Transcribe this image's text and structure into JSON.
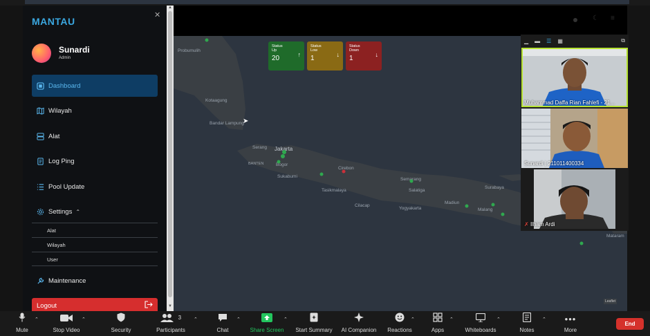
{
  "app": {
    "brand": "MANTAU",
    "user_name": "Sunardi",
    "user_role": "Admin"
  },
  "sidebar": {
    "items": [
      {
        "label": "Dashboard",
        "icon": "dashboard-icon",
        "active": true
      },
      {
        "label": "Wilayah",
        "icon": "map-icon"
      },
      {
        "label": "Alat",
        "icon": "server-icon"
      },
      {
        "label": "Log Ping",
        "icon": "log-icon"
      },
      {
        "label": "Pool Update",
        "icon": "list-icon"
      },
      {
        "label": "Settings",
        "icon": "gear-icon",
        "expanded": true
      }
    ],
    "settings_sub": [
      "Alat",
      "Wilayah",
      "User"
    ],
    "maintenance": "Maintenance",
    "logout": "Logout"
  },
  "status_cards": [
    {
      "title": "Status",
      "subtitle": "Up",
      "value": "20",
      "color": "#1f6b2a",
      "arrow": "↑"
    },
    {
      "title": "Status",
      "subtitle": "Low",
      "value": "1",
      "color": "#8a6a14",
      "arrow": "↓"
    },
    {
      "title": "Status",
      "subtitle": "Down",
      "value": "1",
      "color": "#8c2121",
      "arrow": "↓"
    }
  ],
  "map_labels": [
    "Probumulih",
    "Kotaagung",
    "Bandar Lampung",
    "Serang",
    "Jakarta",
    "BANTEN",
    "Bogor",
    "Sukabumi",
    "Cirebon",
    "Tasikmalaya",
    "Semarang",
    "Cilacap",
    "Yogyakarta",
    "Salatiga",
    "Madiun",
    "Surabaya",
    "Malang",
    "Mataram"
  ],
  "participants": [
    {
      "name": "Muhammad Daffa Rian Fahlefi - 21...",
      "speaking": true
    },
    {
      "name": "Sunardi | 211011400334",
      "speaking": false
    },
    {
      "name": "Ilham Ardi",
      "speaking": false,
      "muted": true
    }
  ],
  "toolbar": {
    "mute": "Mute",
    "stop_video": "Stop Video",
    "security": "Security",
    "participants": "Participants",
    "participants_count": "3",
    "chat": "Chat",
    "share_screen": "Share Screen",
    "start_summary": "Start Summary",
    "ai_companion": "AI Companion",
    "reactions": "Reactions",
    "apps": "Apps",
    "whiteboards": "Whiteboards",
    "notes": "Notes",
    "more": "More",
    "end": "End"
  },
  "colors": {
    "accent": "#3aa7e0",
    "active_nav": "#0e3d64",
    "logout": "#d62e2e",
    "share_green": "#23c55e",
    "end_red": "#d5312b",
    "speaker_border": "#b7e332"
  },
  "map_attribution": "Leaflet"
}
